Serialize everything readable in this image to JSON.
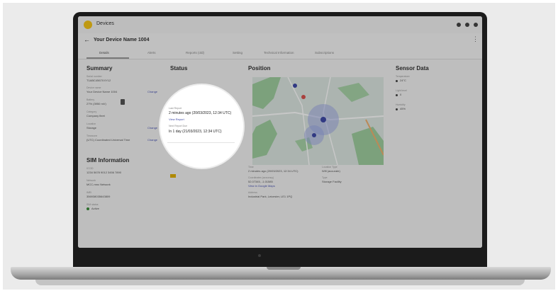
{
  "app": {
    "brand": "Devices",
    "device_title": "Your Device Name 1004",
    "back_glyph": "←",
    "more_glyph": "⋮"
  },
  "tabs": [
    "Details",
    "Alerts",
    "Reports (old)",
    "Setting",
    "Technical Information",
    "Subscriptions"
  ],
  "summary": {
    "title": "Summary",
    "fields": [
      {
        "label": "Serial number",
        "value": "T1ABC4567XXY12"
      },
      {
        "label": "Device name",
        "value": "Your Device Name 1004"
      },
      {
        "label": "Battery",
        "value": "27% (3950 mV)"
      },
      {
        "label": "Category",
        "value": "Company fleet"
      },
      {
        "label": "Location",
        "value": "Storage"
      },
      {
        "label": "Timezone",
        "value": "(UTC) Coordinated Universal Time"
      }
    ],
    "edit_label": "Change"
  },
  "sim": {
    "title": "SIM Information",
    "fields": [
      {
        "label": "ICCID",
        "value": "1234 5678 9012 3456 7890"
      },
      {
        "label": "Network",
        "value": "MCC-mnc Network"
      },
      {
        "label": "IMEI",
        "value": "356938035643809"
      },
      {
        "label": "SIM status",
        "value": "Active"
      }
    ]
  },
  "status": {
    "title": "Status",
    "last_report_label": "Last Report",
    "last_report_value": "2 minutes ago (20/03/2023, 12:34 UTC)",
    "view_report": "View Report",
    "next_report_label": "Next Report Due",
    "next_report_value": "In 1 day (21/03/2023, 12:34 UTC)"
  },
  "position": {
    "title": "Position",
    "time_label": "Time",
    "time_value": "2 minutes ago (20/03/2023, 12:34 UTC)",
    "coords_label": "Coordinates (accuracy)",
    "coords_value": "52.07345, -1.01585",
    "map_link": "View in Google Maps",
    "address_label": "Address",
    "address_value": "Industrial Park, Leicester, LE1 1PQ",
    "source_label": "Location Type",
    "source_value": "Wifi (accurate)",
    "type_label": "Type",
    "type_value": "Storage Facility"
  },
  "sensor": {
    "title": "Sensor Data",
    "items": [
      {
        "label": "Temperature",
        "value": "24°C"
      },
      {
        "label": "Light level",
        "value": "0"
      },
      {
        "label": "Humidity",
        "value": "45%"
      }
    ]
  },
  "colors": {
    "brand_yellow": "#f5c518",
    "link_blue": "#4b55b5",
    "status_green": "#3a8d3a",
    "map_pin_blue": "#3f4aa8",
    "map_pin_red": "#d9534f"
  },
  "icons": [
    "logo-icon",
    "back-arrow-icon",
    "more-icon",
    "battery-icon",
    "status-dot-icon",
    "map-pin-icon"
  ]
}
